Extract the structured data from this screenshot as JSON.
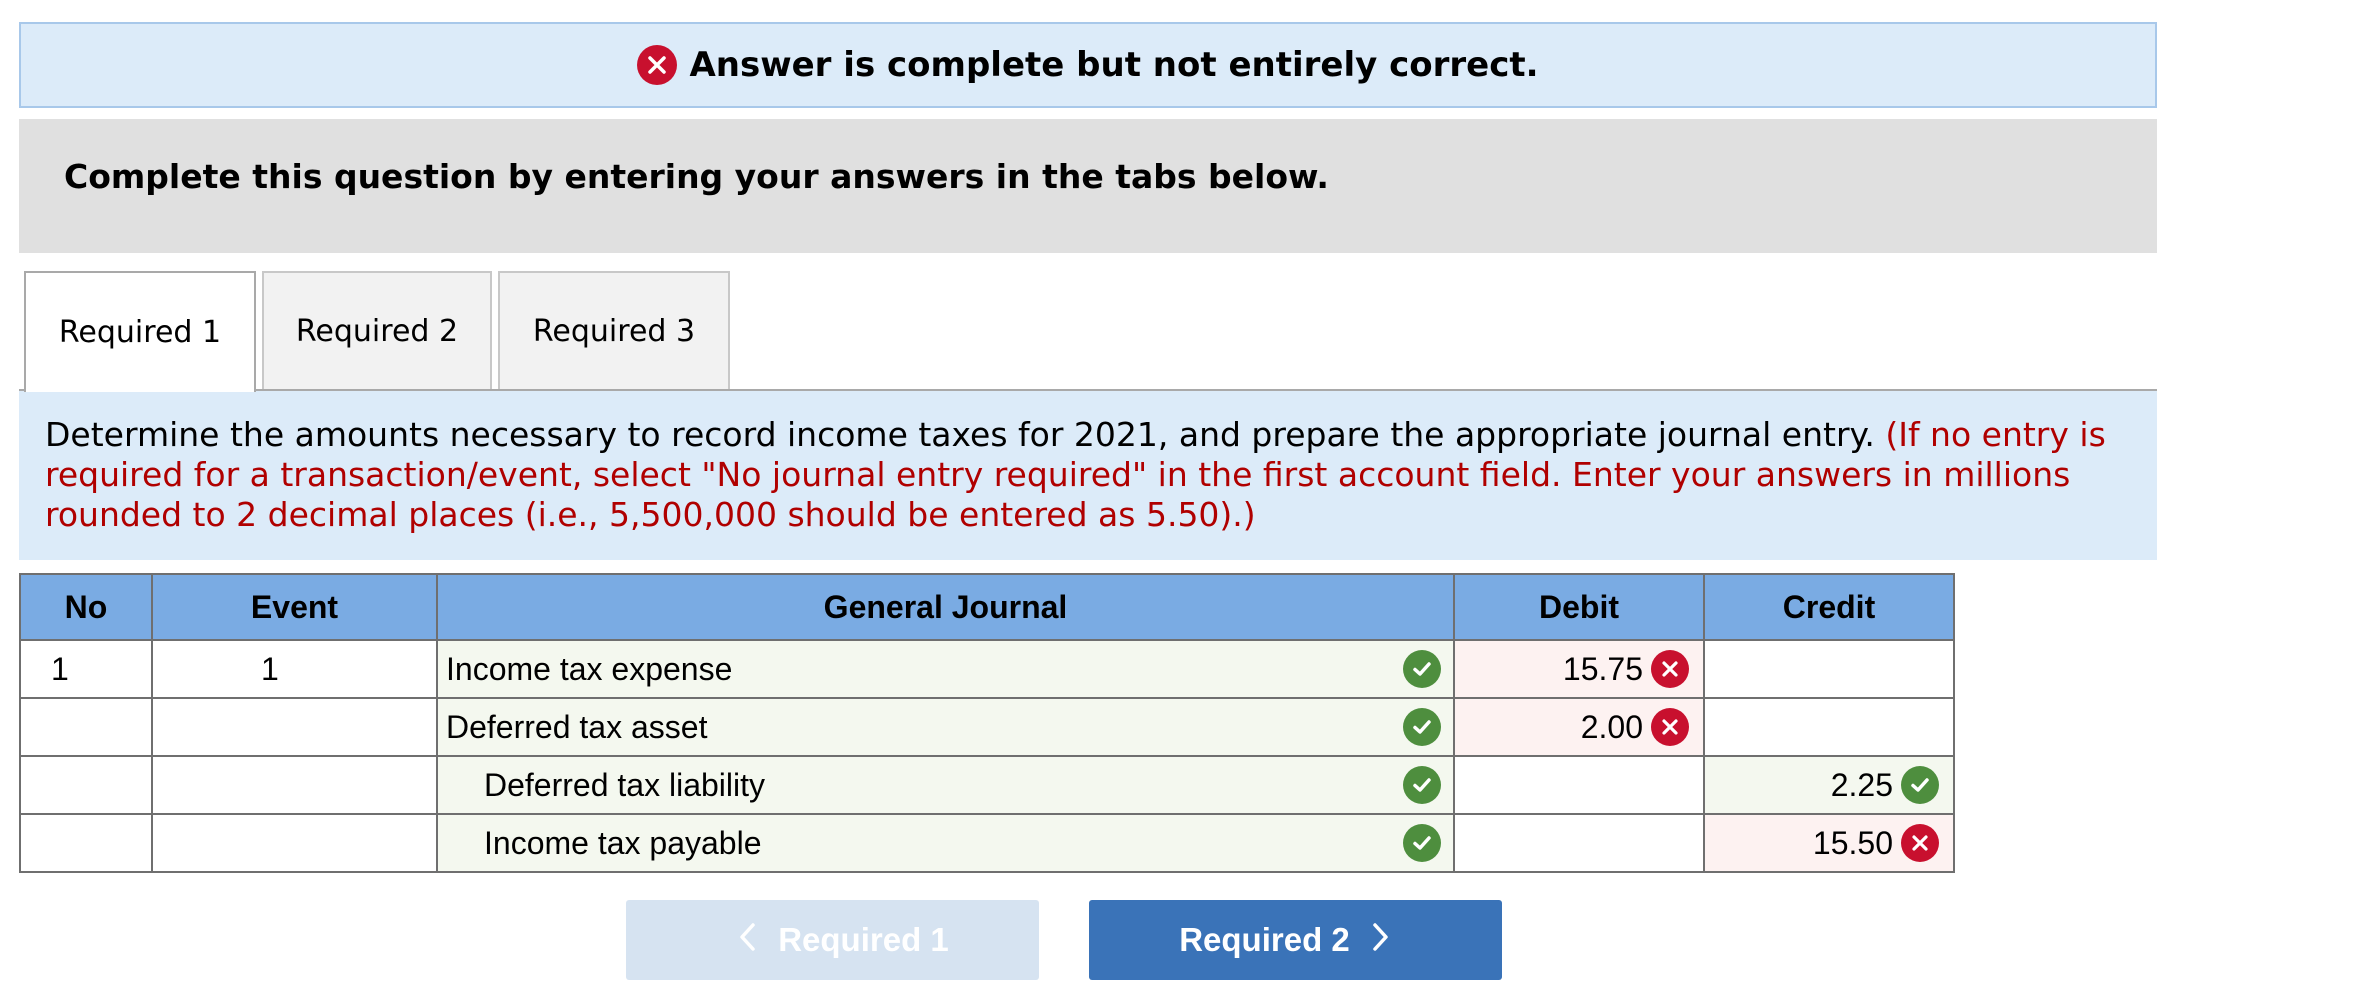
{
  "banner": {
    "icon": "x-circle-icon",
    "icon_color": "#c8102e",
    "text": "Answer is complete but not entirely correct."
  },
  "instructions": {
    "text": "Complete this question by entering your answers in the tabs below."
  },
  "tabs": [
    {
      "label": "Required 1",
      "active": true
    },
    {
      "label": "Required 2",
      "active": false
    },
    {
      "label": "Required 3",
      "active": false
    }
  ],
  "question": {
    "main": "Determine the amounts necessary to record income taxes for 2021, and prepare the appropriate journal entry.",
    "note": "(If no entry is required for a transaction/event, select \"No journal entry required\" in the first account field. Enter your answers in millions rounded to 2 decimal places (i.e., 5,500,000 should be entered as 5.50).)"
  },
  "journal": {
    "headers": {
      "no": "No",
      "event": "Event",
      "general_journal": "General Journal",
      "debit": "Debit",
      "credit": "Credit"
    },
    "rows": [
      {
        "no": "1",
        "event": "1",
        "account": "Income tax expense",
        "account_status": "correct",
        "debit": "15.75",
        "debit_status": "incorrect",
        "credit": "",
        "credit_status": ""
      },
      {
        "no": "",
        "event": "",
        "account": "Deferred tax asset",
        "account_status": "correct",
        "debit": "2.00",
        "debit_status": "incorrect",
        "credit": "",
        "credit_status": ""
      },
      {
        "no": "",
        "event": "",
        "account": "Deferred tax liability",
        "account_status": "correct",
        "debit": "",
        "debit_status": "",
        "credit": "2.25",
        "credit_status": "correct"
      },
      {
        "no": "",
        "event": "",
        "account": "Income tax payable",
        "account_status": "correct",
        "debit": "",
        "debit_status": "",
        "credit": "15.50",
        "credit_status": "incorrect"
      }
    ]
  },
  "navigation": {
    "prev_label": "Required 1",
    "next_label": "Required 2",
    "prev_icon": "chevron-left-icon",
    "next_icon": "chevron-right-icon"
  },
  "colors": {
    "header_blue": "#7aabe3",
    "correct_green": "#4e8e3e",
    "incorrect_red": "#c8102e",
    "next_button": "#3a73b8",
    "prev_button_disabled": "#d6e3f1"
  }
}
